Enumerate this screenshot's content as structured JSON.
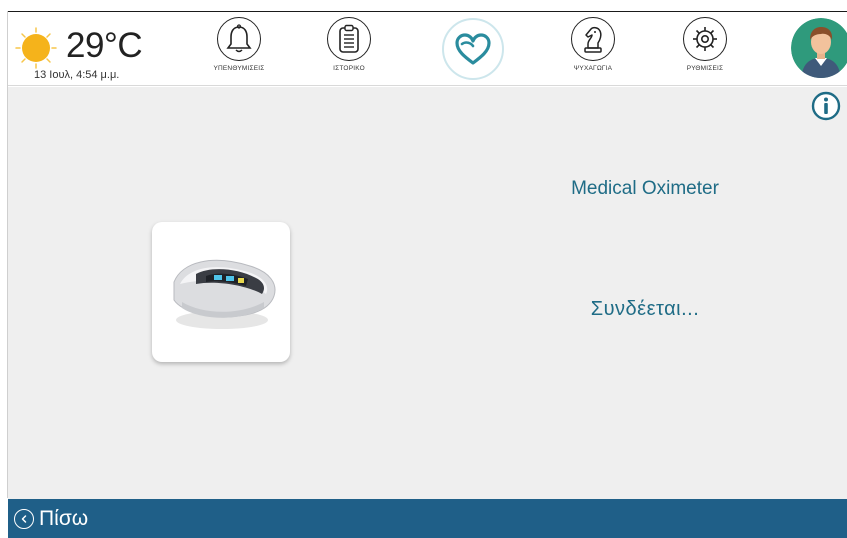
{
  "weather": {
    "icon": "sun-icon",
    "temperature": "29°C",
    "date_time": "13 Ιουλ, 4:54 μ.μ."
  },
  "nav": {
    "items": [
      {
        "label": "ΥΠΕΝΘΥΜΙΣΕΙΣ",
        "icon": "bell-icon"
      },
      {
        "label": "ΙΣΤΟΡΙΚΟ",
        "icon": "clipboard-icon"
      },
      {
        "label": "",
        "icon": "heart-icon"
      },
      {
        "label": "ΨΥΧΑΓΩΓΙΑ",
        "icon": "chess-knight-icon"
      },
      {
        "label": "ΡΥΘΜΙΣΕΙΣ",
        "icon": "gear-icon"
      }
    ],
    "avatar": "user-avatar-icon"
  },
  "main": {
    "device_title": "Medical Oximeter",
    "status": "Συνδέεται..."
  },
  "footer": {
    "back_label": "Πίσω"
  },
  "colors": {
    "accent": "#1f6c86",
    "footer": "#1f5f88",
    "sun": "#f5b31b",
    "heart": "#2a8c9e",
    "avatar_bg": "#2f9a7c"
  }
}
